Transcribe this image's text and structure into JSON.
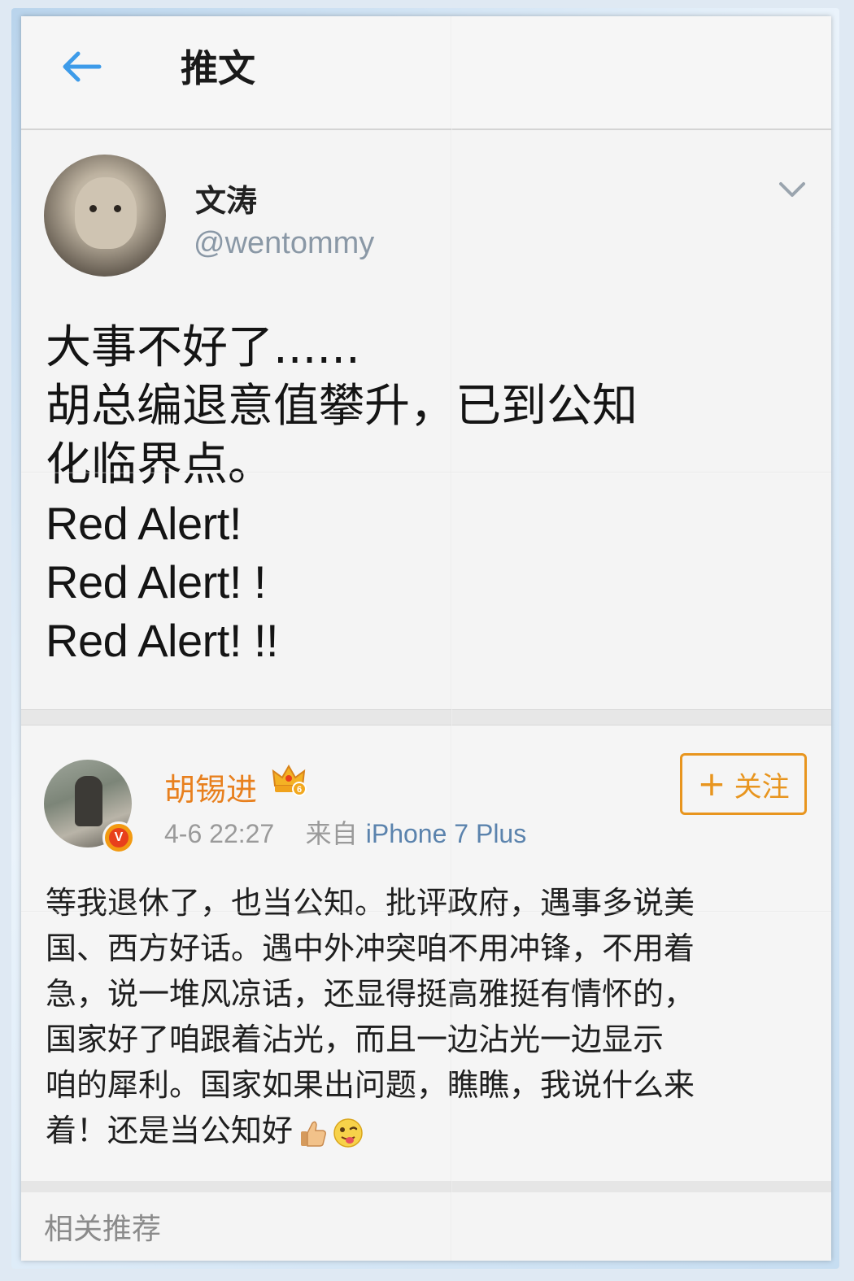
{
  "header": {
    "title": "推文"
  },
  "tweet": {
    "display_name": "文涛",
    "handle": "@wentommy",
    "lines": [
      "大事不好了......",
      "胡总编退意值攀升，已到公知",
      "化临界点。",
      "Red Alert!",
      "Red Alert! !",
      "Red Alert! !!"
    ]
  },
  "reply": {
    "name": "胡锡进",
    "time": "4-6 22:27",
    "from_label": "来自",
    "source": "iPhone 7 Plus",
    "follow_plus": "+",
    "follow_label": "关注",
    "verified_mark": "V",
    "crown_mark": "6",
    "lines": [
      "等我退休了，也当公知。批评政府，遇事多说美",
      "国、西方好话。遇中外冲突咱不用冲锋，不用着",
      "急，说一堆风凉话，还显得挺高雅挺有情怀的，",
      "国家好了咱跟着沾光，而且一边沾光一边显示",
      "咱的犀利。国家如果出问题，瞧瞧，我说什么来",
      "着！还是当公知好"
    ],
    "emojis": [
      "thumbs-up-emoji",
      "tongue-out-emoji"
    ]
  },
  "footer": {
    "related_label": "相关推荐"
  },
  "colors": {
    "accent_blue": "#3d9be9",
    "name_orange": "#e8801e",
    "follow_orange": "#e8951e",
    "source_blue": "#5b83ad"
  }
}
